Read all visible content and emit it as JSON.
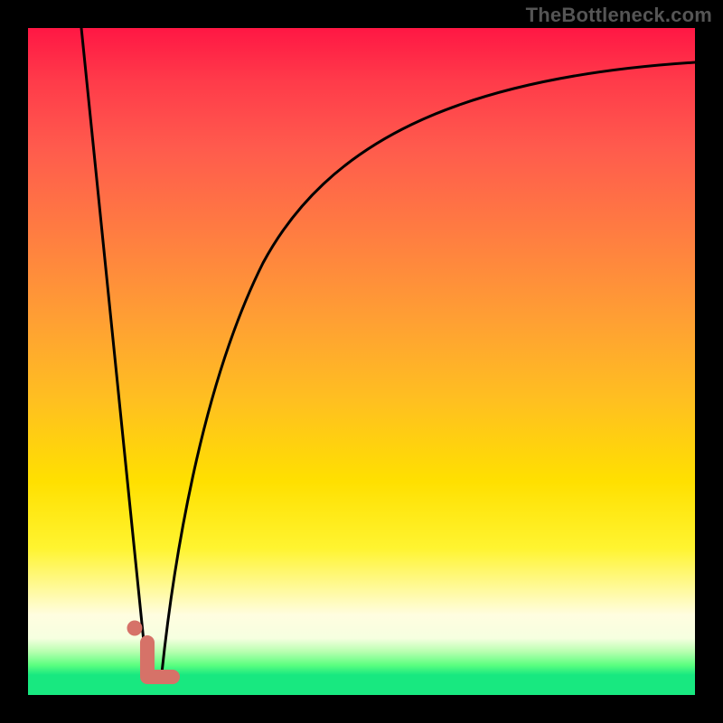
{
  "watermark": "TheBottleneck.com",
  "chart_data": {
    "type": "line",
    "title": "",
    "xlabel": "",
    "ylabel": "",
    "xlim": [
      0,
      100
    ],
    "ylim": [
      0,
      100
    ],
    "grid": false,
    "legend": false,
    "series": [
      {
        "name": "left-line",
        "x": [
          8,
          10,
          12,
          14,
          16,
          17.8
        ],
        "y": [
          100,
          80,
          60,
          40,
          20,
          4
        ]
      },
      {
        "name": "right-curve",
        "x": [
          20,
          22,
          26,
          30,
          35,
          40,
          50,
          60,
          70,
          80,
          90,
          100
        ],
        "y": [
          3,
          15,
          35,
          50,
          62,
          70,
          80,
          86,
          90,
          92.5,
          94,
          95
        ]
      }
    ],
    "annotations": [
      {
        "name": "dot-marker",
        "x": 16,
        "y": 10
      },
      {
        "name": "hook-marker",
        "x_range": [
          17,
          21.5
        ],
        "y_range": [
          2,
          8
        ]
      }
    ]
  }
}
